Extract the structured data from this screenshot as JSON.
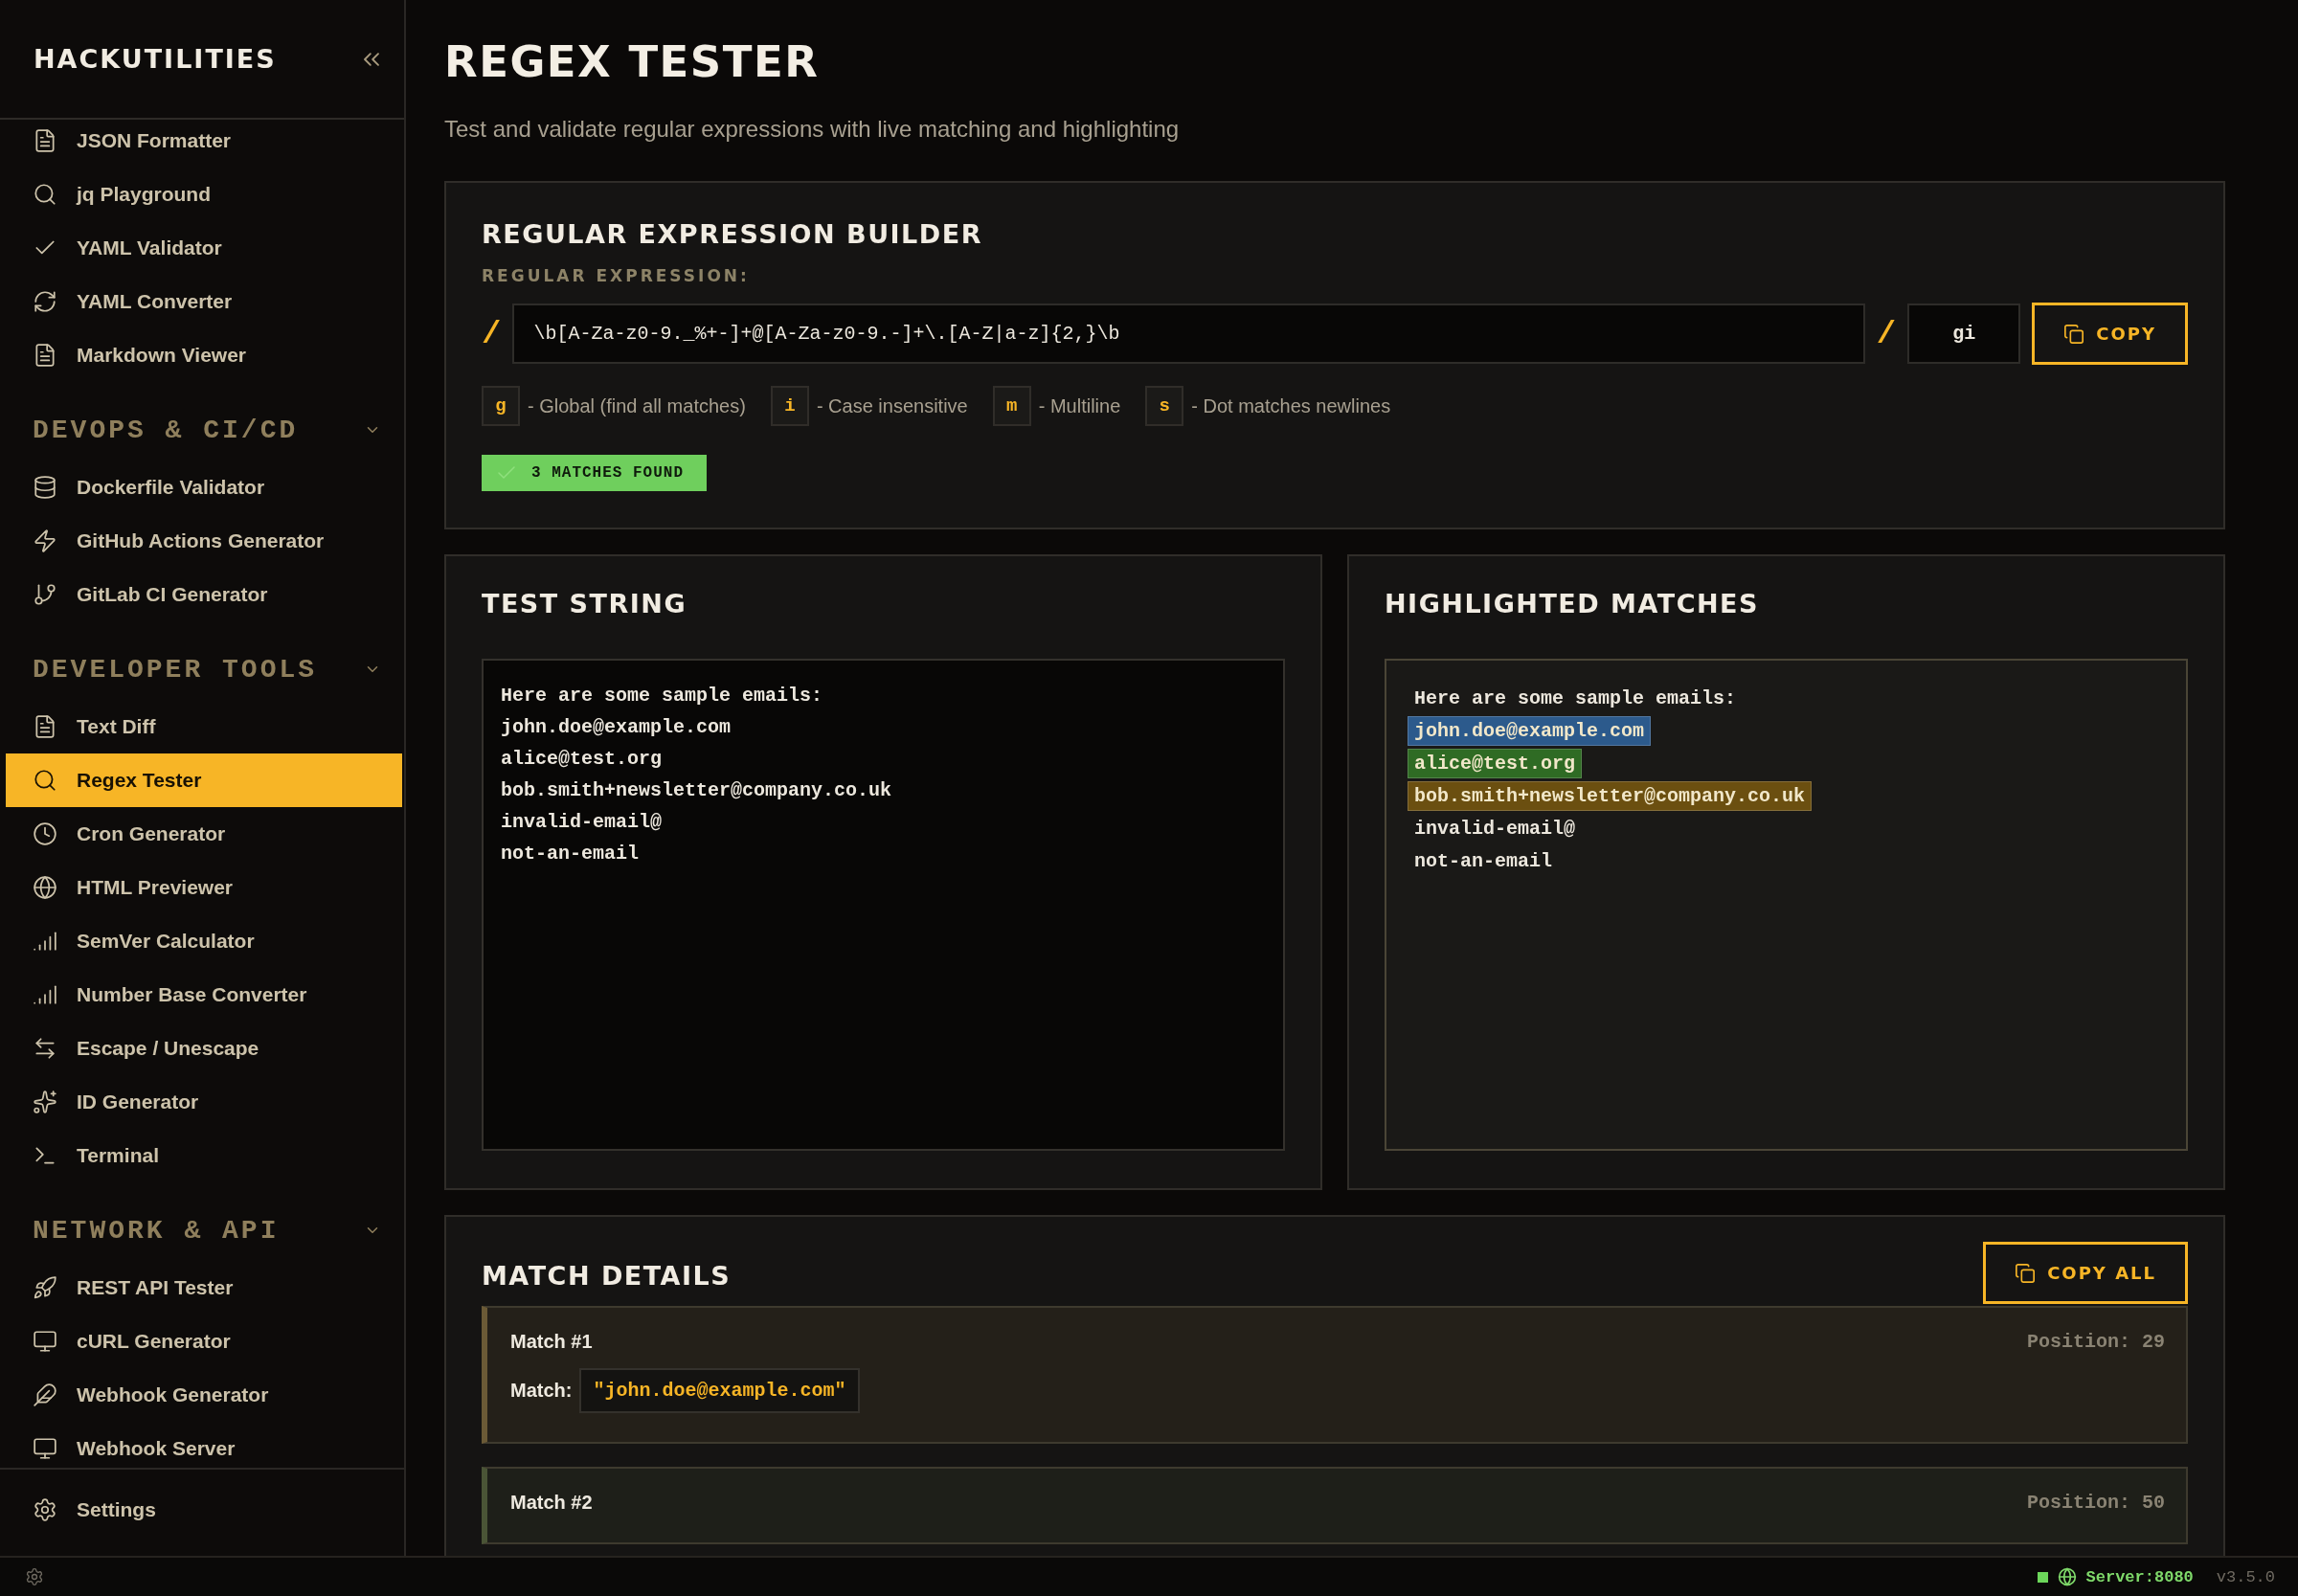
{
  "sidebar": {
    "brand": "HACKUTILITIES",
    "groups": [
      {
        "items": [
          {
            "label": "JSON Formatter",
            "selected": false
          },
          {
            "label": "jq Playground",
            "selected": false
          },
          {
            "label": "YAML Validator",
            "selected": false
          },
          {
            "label": "YAML Converter",
            "selected": false
          },
          {
            "label": "Markdown Viewer",
            "selected": false
          }
        ]
      },
      {
        "title": "DEVOPS & CI/CD",
        "expanded": true,
        "items": [
          {
            "label": "Dockerfile Validator",
            "selected": false
          },
          {
            "label": "GitHub Actions Generator",
            "selected": false
          },
          {
            "label": "GitLab CI Generator",
            "selected": false
          }
        ]
      },
      {
        "title": "DEVELOPER TOOLS",
        "expanded": true,
        "items": [
          {
            "label": "Text Diff",
            "selected": false
          },
          {
            "label": "Regex Tester",
            "selected": true
          },
          {
            "label": "Cron Generator",
            "selected": false
          },
          {
            "label": "HTML Previewer",
            "selected": false
          },
          {
            "label": "SemVer Calculator",
            "selected": false
          },
          {
            "label": "Number Base Converter",
            "selected": false
          },
          {
            "label": "Escape / Unescape",
            "selected": false
          },
          {
            "label": "ID Generator",
            "selected": false
          },
          {
            "label": "Terminal",
            "selected": false
          }
        ]
      },
      {
        "title": "NETWORK & API",
        "expanded": true,
        "items": [
          {
            "label": "REST API Tester",
            "selected": false
          },
          {
            "label": "cURL Generator",
            "selected": false
          },
          {
            "label": "Webhook Generator",
            "selected": false
          },
          {
            "label": "Webhook Server",
            "selected": false
          }
        ]
      }
    ],
    "settings": "Settings"
  },
  "page": {
    "title": "REGEX TESTER",
    "subtitle": "Test and validate regular expressions with live matching and highlighting"
  },
  "builder": {
    "title": "REGULAR EXPRESSION BUILDER",
    "label": "REGULAR EXPRESSION:",
    "slash": "/",
    "pattern": "\\b[A-Za-z0-9._%+-]+@[A-Za-z0-9.-]+\\.[A-Z|a-z]{2,}\\b",
    "flags_value": "gi",
    "copy": "COPY",
    "flags": [
      {
        "key": "g",
        "label": "- Global (find all matches)"
      },
      {
        "key": "i",
        "label": "- Case insensitive"
      },
      {
        "key": "m",
        "label": "- Multiline"
      },
      {
        "key": "s",
        "label": "- Dot matches newlines"
      }
    ],
    "result": "3 MATCHES FOUND"
  },
  "test_string": {
    "title": "TEST STRING",
    "value": "Here are some sample emails:\njohn.doe@example.com\nalice@test.org\nbob.smith+newsletter@company.co.uk\ninvalid-email@\nnot-an-email"
  },
  "highlighted": {
    "title": "HIGHLIGHTED MATCHES",
    "lines": [
      {
        "text": "Here are some sample emails:"
      },
      {
        "text": "john.doe@example.com",
        "color": "#2c5a8c"
      },
      {
        "text": "alice@test.org",
        "color": "#2f6b24"
      },
      {
        "text": "bob.smith+newsletter@company.co.uk",
        "color": "#6b4f10"
      },
      {
        "text": "invalid-email@"
      },
      {
        "text": "not-an-email"
      }
    ]
  },
  "match_details": {
    "title": "MATCH DETAILS",
    "copy_all": "COPY ALL",
    "matches": [
      {
        "title": "Match #1",
        "position": "Position: 29",
        "label": "Match:",
        "value": "\"john.doe@example.com\"",
        "color": "#6b5a36"
      },
      {
        "title": "Match #2",
        "position": "Position: 50",
        "color": "#4a5436"
      }
    ]
  },
  "status_bar": {
    "server": "Server:8080",
    "version": "v3.5.0"
  }
}
